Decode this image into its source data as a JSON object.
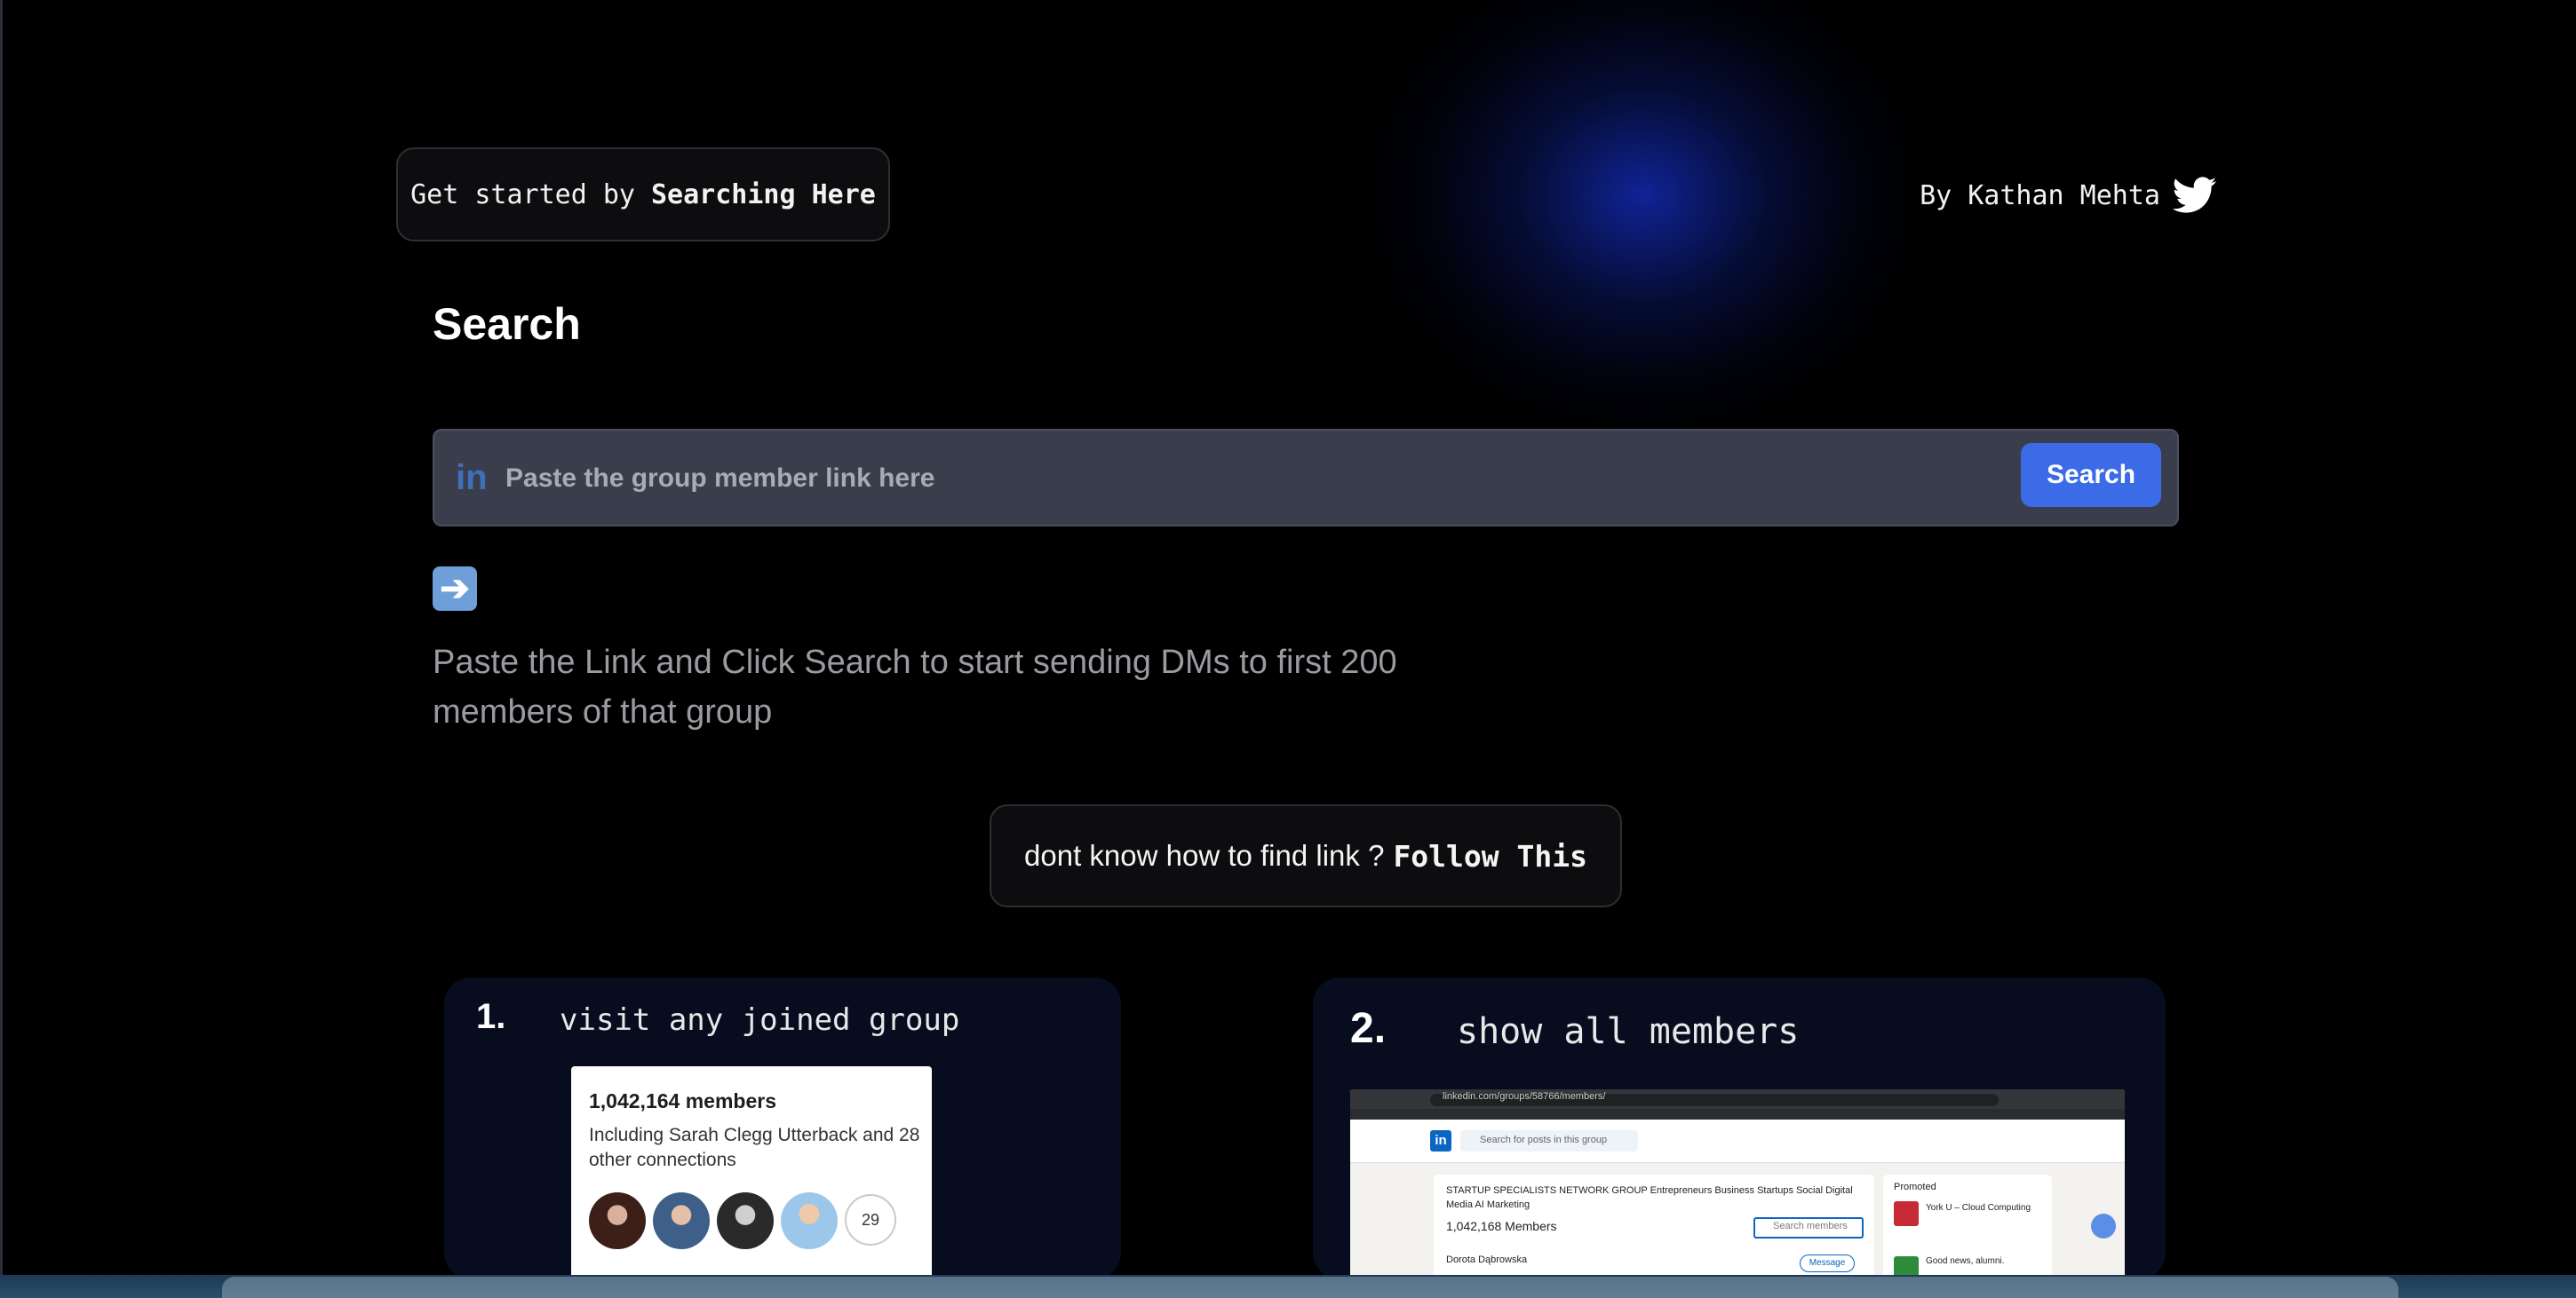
{
  "header": {
    "start_prefix": "Get started by",
    "start_bold": "Searching Here",
    "author": "By Kathan Mehta"
  },
  "search": {
    "title": "Search",
    "icon": "linkedin-icon",
    "placeholder": "Paste the group member link here",
    "button_label": "Search"
  },
  "hint": {
    "icon": "right-arrow-emoji",
    "text": "Paste the Link and Click Search to start sending DMs to first 200 members of that group"
  },
  "follow": {
    "prefix": "dont know how to find link ?",
    "bold": "Follow This"
  },
  "steps": [
    {
      "number": "1.",
      "text": "visit any joined group",
      "card": {
        "members": "1,042,164 members",
        "including": "Including Sarah Clegg Utterback and 28 other connections",
        "more_count": "29"
      }
    },
    {
      "number": "2.",
      "text": "show all members",
      "shot": {
        "url": "linkedin.com/groups/58766/members/",
        "search_placeholder": "Search for posts in this group",
        "group_name": "STARTUP SPECIALISTS NETWORK GROUP Entrepreneurs Business Startups Social Digital Media AI Marketing",
        "members": "1,042,168 Members",
        "search_members": "Search members",
        "person": "Dorota Dąbrowska",
        "message": "Message",
        "promoted": "Promoted",
        "promo1": "York U – Cloud Computing",
        "promo2": "Good news, alumni."
      }
    }
  ],
  "colors": {
    "accent": "#3b6be6",
    "glow": "#142dbe",
    "background": "#000000"
  }
}
